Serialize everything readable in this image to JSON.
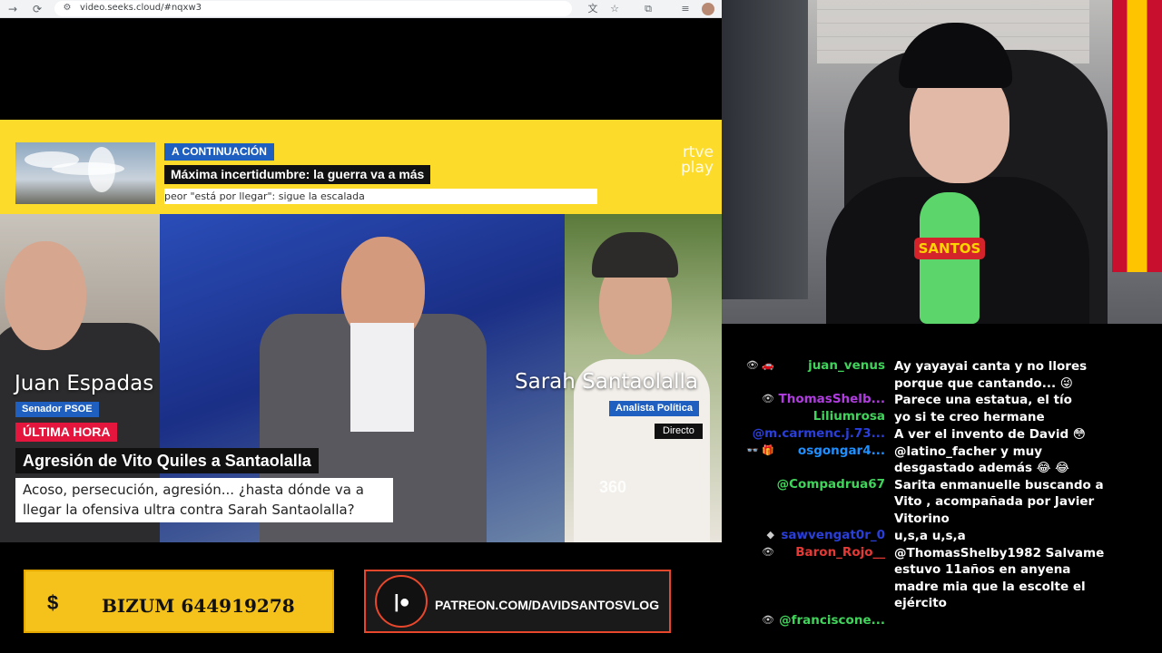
{
  "browser": {
    "url": "video.seeks.cloud/#nqxw3",
    "icons": [
      "forward-icon",
      "reload-icon",
      "site-settings-icon",
      "translate-icon",
      "bookmark-star-icon",
      "extensions-icon",
      "media-controls-icon",
      "profile-avatar"
    ]
  },
  "broadcast": {
    "next_label": "A CONTINUACIÓN",
    "next_title": "Máxima incertidumbre: la guerra va a más",
    "next_ticker": "peor \"está por llegar\": sigue la escalada",
    "logo_line1": "rtve",
    "logo_line2": "play",
    "left_name": "Juan Espadas",
    "left_role": "Senador PSOE",
    "right_name": "Sarah Santaolalla",
    "right_role": "Analista Política",
    "live_label": "Directo",
    "watermark": "360",
    "urgent_label": "ÚLTIMA HORA",
    "headline": "Agresión de Vito Quiles a Santaolalla",
    "subhead_line1": "Acoso, persecución, agresión... ¿hasta dónde va a",
    "subhead_line2": "llegar la ofensiva ultra contra Sarah Santaolalla?"
  },
  "banners": {
    "bizum_icon": "$",
    "bizum_text": "BIZUM 644919278",
    "patreon_text": "PATREON.COM/DAVIDSANTOSVLOG"
  },
  "webcam": {
    "mic_label": "SANTOS"
  },
  "chat": {
    "messages": [
      {
        "user": "juan_venus",
        "color": "#3fd45a",
        "badge": "👁 🚗",
        "lines": [
          "Ay yayayai canta y no llores",
          "porque que cantando... 😜"
        ]
      },
      {
        "user": "ThomasShelb...",
        "color": "#b13ce0",
        "badge": "👁",
        "lines": [
          "Parece una estatua, el tío"
        ]
      },
      {
        "user": "Liliumrosa",
        "color": "#3fd45a",
        "badge": "",
        "lines": [
          "yo si te creo hermane"
        ]
      },
      {
        "user": "@m.carmenc.j.73...",
        "color": "#2a3fd9",
        "badge": "",
        "lines": [
          "A ver el invento de David 😳"
        ]
      },
      {
        "user": "osgongar4...",
        "color": "#1e90ff",
        "badge": "👓 🎁",
        "lines": [
          "@latino_facher y muy",
          "desgastado además 😂 😂"
        ]
      },
      {
        "user": "@Compadrua67",
        "color": "#3fd45a",
        "badge": "",
        "lines": [
          "Sarita enmanuelle buscando a",
          "Vito , acompañada por Javier",
          "Vitorino"
        ]
      },
      {
        "user": "sawvengat0r_0",
        "color": "#2a3fd9",
        "badge": "◆",
        "lines": [
          "u,s,a u,s,a"
        ]
      },
      {
        "user": "Baron_Rojo__",
        "color": "#e53935",
        "badge": "👁",
        "lines": [
          "@ThomasShelby1982 Salvame",
          "estuvo 11años en anyena",
          "madre mia que la escolte el",
          "ejército"
        ]
      },
      {
        "user": "@franciscone...",
        "color": "#3fd45a",
        "badge": "👁",
        "lines": []
      }
    ]
  }
}
